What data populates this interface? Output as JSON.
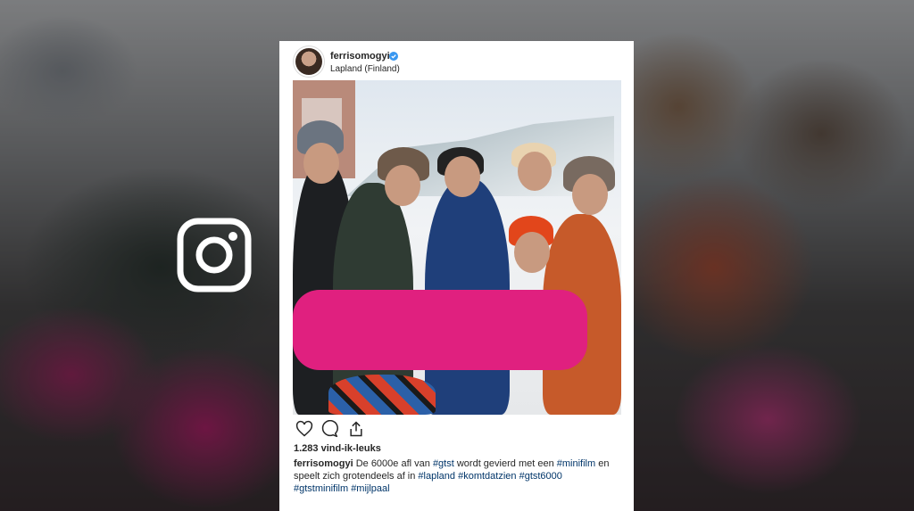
{
  "post": {
    "username": "ferrisomogyi",
    "verified": true,
    "location": "Lapland (Finland)",
    "likes": "1.283 vind-ik-leuks",
    "caption": {
      "user": "ferrisomogyi",
      "segments": [
        {
          "type": "text",
          "value": " De 6000e afl van "
        },
        {
          "type": "tag",
          "value": "#gtst"
        },
        {
          "type": "text",
          "value": " wordt gevierd met een "
        },
        {
          "type": "tag",
          "value": "#minifilm"
        },
        {
          "type": "text",
          "value": " en speelt zich grotendeels af in "
        },
        {
          "type": "tag",
          "value": "#lapland"
        },
        {
          "type": "text",
          "value": " "
        },
        {
          "type": "tag",
          "value": "#komtdatzien"
        },
        {
          "type": "text",
          "value": " "
        },
        {
          "type": "tag",
          "value": "#gtst6000"
        },
        {
          "type": "text",
          "value": " "
        },
        {
          "type": "tag",
          "value": "#gtstminifilm"
        },
        {
          "type": "text",
          "value": " "
        },
        {
          "type": "tag",
          "value": "#mijlpaal"
        }
      ]
    },
    "actions": [
      {
        "name": "like-icon"
      },
      {
        "name": "comment-icon"
      },
      {
        "name": "share-icon"
      }
    ]
  },
  "overlay_icon": "instagram-logo-icon",
  "colors": {
    "verified_badge": "#3897f0",
    "hashtag": "#003569",
    "text": "#262626"
  }
}
